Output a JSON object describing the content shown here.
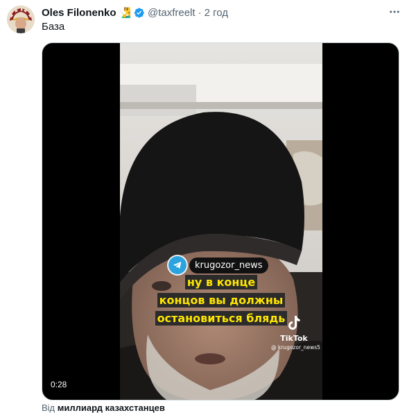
{
  "author": {
    "name": "Oles Filonenko",
    "emoji": "🧏‍♂️",
    "handle": "@taxfreelt",
    "separator": "·",
    "timestamp": "2 год"
  },
  "tweet": {
    "text": "База"
  },
  "video": {
    "telegram_channel": "krugozor_news",
    "caption_lines": [
      "ну в конце",
      "концов вы должны",
      "остановиться блядь"
    ],
    "watermark_brand": "TikTok",
    "watermark_user": "@ krugozor_news5",
    "duration": "0:28"
  },
  "attribution": {
    "prefix": "Від",
    "source": "миллиард казахстанцев"
  },
  "colors": {
    "verified": "#1d9bf0",
    "telegram": "#2aa3df",
    "caption_text": "#ffe600",
    "muted": "#536471"
  },
  "icons": [
    "verified-badge-icon",
    "more-icon",
    "telegram-icon",
    "tiktok-icon"
  ]
}
